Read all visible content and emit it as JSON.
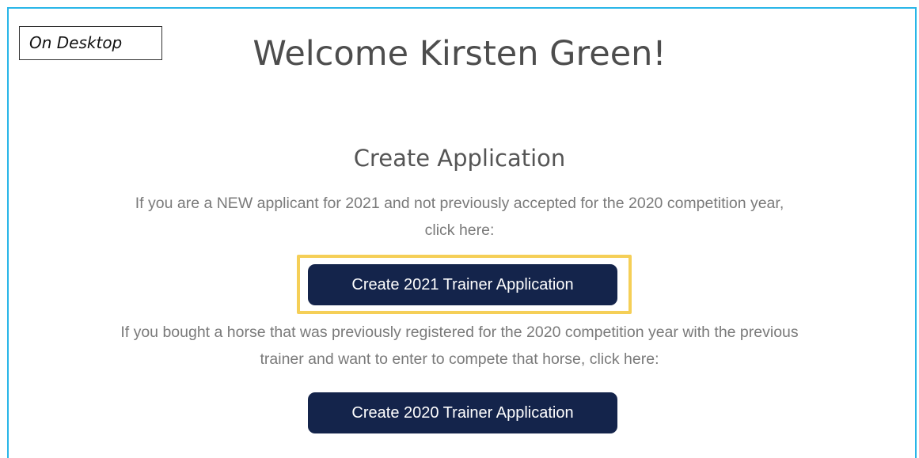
{
  "annotation": {
    "label": "On Desktop"
  },
  "header": {
    "welcome": "Welcome Kirsten Green!"
  },
  "create_application": {
    "title": "Create Application",
    "new_applicant_text": [
      "If you are a NEW applicant for 2021 and not previously accepted for the 2020 competition year,",
      "click here:"
    ],
    "button_2021_label": "Create 2021 Trainer Application",
    "bought_horse_text": [
      "If you bought a horse that was previously registered for the 2020 competition year with the previous",
      "trainer and want to enter to compete that horse, click here:"
    ],
    "button_2020_label": "Create 2020 Trainer Application"
  },
  "colors": {
    "frame_border": "#29b6e8",
    "button_bg": "#14244b",
    "highlight": "#f5cf57"
  }
}
